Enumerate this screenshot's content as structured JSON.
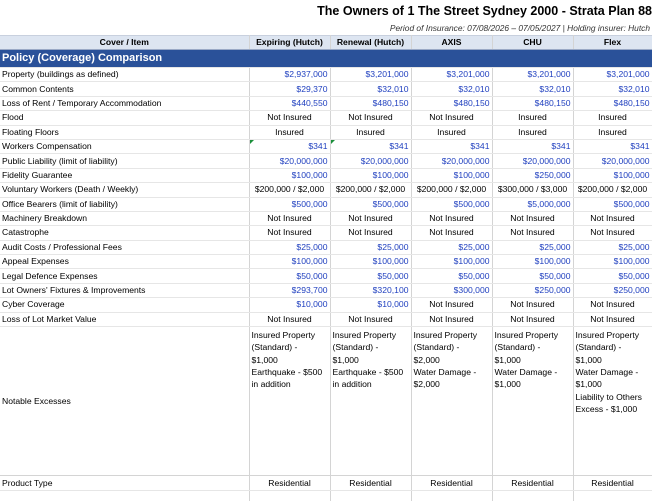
{
  "header": {
    "title": "The Owners of 1 The Street Sydney 2000 - Strata Plan 88",
    "subtitle": "Period of Insurance: 07/08/2026 – 07/05/2027  |  Holding insurer: Hutch"
  },
  "columns": {
    "item": "Cover / Item",
    "insurers": [
      "Expiring (Hutch)",
      "Renewal (Hutch)",
      "AXIS",
      "CHU",
      "Flex"
    ]
  },
  "section_title": "Policy (Coverage) Comparison",
  "rows": [
    {
      "label": "Property (buildings as defined)",
      "values": [
        "$2,937,000",
        "$3,201,000",
        "$3,201,000",
        "$3,201,000",
        "$3,201,000"
      ]
    },
    {
      "label": "Common Contents",
      "values": [
        "$29,370",
        "$32,010",
        "$32,010",
        "$32,010",
        "$32,010"
      ]
    },
    {
      "label": "Loss of Rent / Temporary Accommodation",
      "values": [
        "$440,550",
        "$480,150",
        "$480,150",
        "$480,150",
        "$480,150"
      ]
    },
    {
      "label": "Flood",
      "values": [
        "Not Insured",
        "Not Insured",
        "Not Insured",
        "Insured",
        "Insured"
      ]
    },
    {
      "label": "Floating Floors",
      "values": [
        "Insured",
        "Insured",
        "Insured",
        "Insured",
        "Insured"
      ]
    },
    {
      "label": "Workers Compensation",
      "values": [
        "$341",
        "$341",
        "$341",
        "$341",
        "$341"
      ]
    },
    {
      "label": "Public Liability (limit of liability)",
      "values": [
        "$20,000,000",
        "$20,000,000",
        "$20,000,000",
        "$20,000,000",
        "$20,000,000"
      ]
    },
    {
      "label": "Fidelity Guarantee",
      "values": [
        "$100,000",
        "$100,000",
        "$100,000",
        "$250,000",
        "$100,000"
      ]
    },
    {
      "label": "Voluntary Workers (Death / Weekly)",
      "values": [
        "$200,000 / $2,000",
        "$200,000 / $2,000",
        "$200,000 / $2,000",
        "$300,000 / $3,000",
        "$200,000 / $2,000"
      ]
    },
    {
      "label": "Office Bearers (limit of liability)",
      "values": [
        "$500,000",
        "$500,000",
        "$500,000",
        "$5,000,000",
        "$500,000"
      ]
    },
    {
      "label": "Machinery Breakdown",
      "values": [
        "Not Insured",
        "Not Insured",
        "Not Insured",
        "Not Insured",
        "Not Insured"
      ]
    },
    {
      "label": "Catastrophe",
      "values": [
        "Not Insured",
        "Not Insured",
        "Not Insured",
        "Not Insured",
        "Not Insured"
      ]
    },
    {
      "label": "Audit Costs / Professional Fees",
      "values": [
        "$25,000",
        "$25,000",
        "$25,000",
        "$25,000",
        "$25,000"
      ]
    },
    {
      "label": "Appeal Expenses",
      "values": [
        "$100,000",
        "$100,000",
        "$100,000",
        "$100,000",
        "$100,000"
      ]
    },
    {
      "label": "Legal Defence Expenses",
      "values": [
        "$50,000",
        "$50,000",
        "$50,000",
        "$50,000",
        "$50,000"
      ]
    },
    {
      "label": "Lot Owners' Fixtures & Improvements",
      "values": [
        "$293,700",
        "$320,100",
        "$300,000",
        "$250,000",
        "$250,000"
      ]
    },
    {
      "label": "Cyber Coverage",
      "values": [
        "$10,000",
        "$10,000",
        "Not Insured",
        "Not Insured",
        "Not Insured"
      ]
    },
    {
      "label": "Loss of Lot Market Value",
      "values": [
        "Not Insured",
        "Not Insured",
        "Not Insured",
        "Not Insured",
        "Not Insured"
      ]
    }
  ],
  "notable_excesses": {
    "label": "Notable Excesses",
    "cells": [
      [
        "Insured Property",
        "(Standard) -",
        "$1,000",
        "Earthquake - $500",
        "in addition"
      ],
      [
        "Insured Property",
        "(Standard) -",
        "$1,000",
        "Earthquake - $500",
        "in addition"
      ],
      [
        "Insured Property",
        "(Standard) -",
        "$2,000",
        "Water Damage -",
        "$2,000"
      ],
      [
        "Insured Property",
        "(Standard) -",
        "$1,000",
        "Water Damage -",
        "$1,000"
      ],
      [
        "Insured Property",
        "(Standard) -",
        "$1,000",
        "Water Damage -",
        "$1,000",
        "Liability to Others",
        "Excess - $1,000"
      ]
    ]
  },
  "product_type": {
    "label": "Product Type",
    "values": [
      "Residential",
      "Residential",
      "Residential",
      "Residential",
      "Residential"
    ]
  },
  "colors": {
    "section_bg": "#2a5199",
    "header_bg": "#dde5f1",
    "value_blue": "#1f3fbf",
    "comment_marker": "#1b8f3a"
  }
}
